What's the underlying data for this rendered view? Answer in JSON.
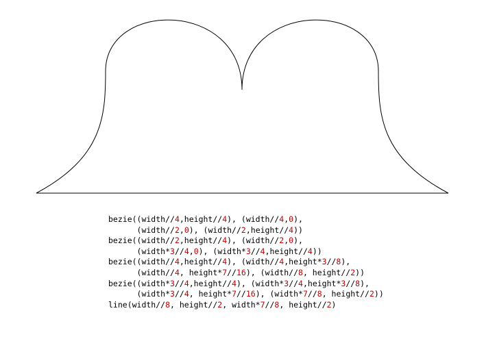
{
  "colors": {
    "background": "#ffffff",
    "stroke": "#000000",
    "code_text": "#000000",
    "code_number": "#c00000"
  },
  "code_lines": [
    "bezie((width//4,height//4), (width//4,0),",
    "      (width//2,0), (width//2,height//4))",
    "bezie((width//2,height//4), (width//2,0),",
    "      (width*3//4,0), (width*3//4,height//4))",
    "bezie((width//4,height//4), (width//4,height*3//8),",
    "      (width//4, height*7//16), (width//8, height//2))",
    "bezie((width*3//4,height//4), (width*3//4,height*3//8),",
    "      (width*3//4, height*7//16), (width*7//8, height//2))",
    "line(width//8, height//2, width*7//8, height//2)"
  ]
}
